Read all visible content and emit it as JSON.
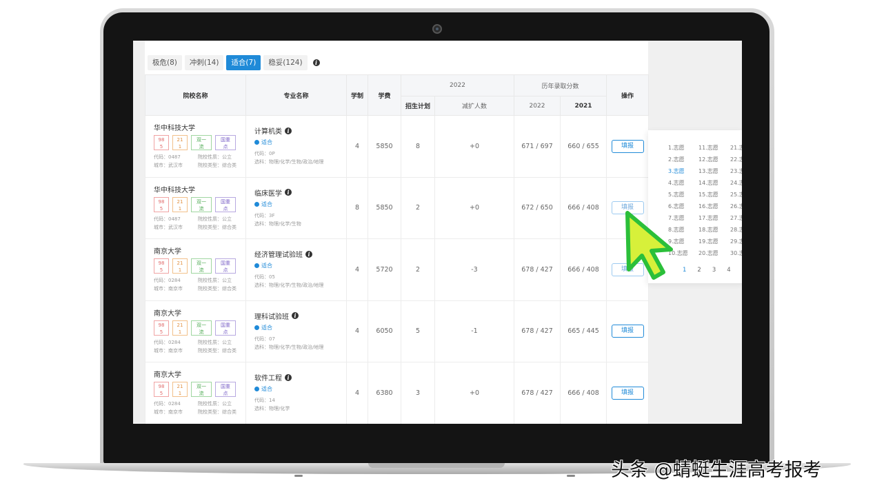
{
  "tabs": [
    {
      "label": "极危(8)"
    },
    {
      "label": "冲刺(14)"
    },
    {
      "label": "适合(7)"
    },
    {
      "label": "稳妥(124)"
    }
  ],
  "table": {
    "headers": {
      "school": "院校名称",
      "major": "专业名称",
      "duration": "学制",
      "tuition": "学费",
      "year_group": "2022",
      "plan": "招生计划",
      "change": "减扩人数",
      "history": "历年录取分数",
      "y2022": "2022",
      "y2021": "2021",
      "action": "操作"
    },
    "rows": [
      {
        "school": "华中科技大学",
        "badges": [
          "98\n5",
          "21\n1",
          "双一\n流",
          "国重\n点"
        ],
        "code": "代码：0487",
        "nature": "院校性质：公立",
        "city": "城市：武汉市",
        "type": "院校类型：综合类",
        "major": "计算机类",
        "fit": "适合",
        "major_code": "代码：0P",
        "subjects": "选科：物理/化学/生物/政治/地理",
        "duration": "4",
        "tuition": "5850",
        "plan": "8",
        "change": "+0",
        "s2022": "671 / 697",
        "s2021": "660 / 655",
        "btn": "填报"
      },
      {
        "school": "华中科技大学",
        "badges": [
          "98\n5",
          "21\n1",
          "双一\n流",
          "国重\n点"
        ],
        "code": "代码：0487",
        "nature": "院校性质：公立",
        "city": "城市：武汉市",
        "type": "院校类型：综合类",
        "major": "临床医学",
        "fit": "适合",
        "major_code": "代码：3F",
        "subjects": "选科：物理/化学/生物",
        "duration": "8",
        "tuition": "5850",
        "plan": "2",
        "change": "+0",
        "s2022": "672 / 650",
        "s2021": "666 / 408",
        "btn": "填报"
      },
      {
        "school": "南京大学",
        "badges": [
          "98\n5",
          "21\n1",
          "双一\n流",
          "国重\n点"
        ],
        "code": "代码：0284",
        "nature": "院校性质：公立",
        "city": "城市：南京市",
        "type": "院校类型：综合类",
        "major": "经济管理试验班",
        "fit": "适合",
        "major_code": "代码：05",
        "subjects": "选科：物理/化学/生物/政治/地理",
        "duration": "4",
        "tuition": "5720",
        "plan": "2",
        "change": "-3",
        "s2022": "678 / 427",
        "s2021": "666 / 408",
        "btn": "填报"
      },
      {
        "school": "南京大学",
        "badges": [
          "98\n5",
          "21\n1",
          "双一\n流",
          "国重\n点"
        ],
        "code": "代码：0284",
        "nature": "院校性质：公立",
        "city": "城市：南京市",
        "type": "院校类型：综合类",
        "major": "理科试验班",
        "fit": "适合",
        "major_code": "代码：07",
        "subjects": "选科：物理/化学/生物/政治/地理",
        "duration": "4",
        "tuition": "6050",
        "plan": "5",
        "change": "-1",
        "s2022": "678 / 427",
        "s2021": "665 / 445",
        "btn": "填报"
      },
      {
        "school": "南京大学",
        "badges": [
          "98\n5",
          "21\n1",
          "双一\n流",
          "国重\n点"
        ],
        "code": "代码：0284",
        "nature": "院校性质：公立",
        "city": "城市：南京市",
        "type": "院校类型：综合类",
        "major": "软件工程",
        "fit": "适合",
        "major_code": "代码：14",
        "subjects": "选科：物理/化学",
        "duration": "4",
        "tuition": "6380",
        "plan": "3",
        "change": "+0",
        "s2022": "678 / 427",
        "s2021": "666 / 408",
        "btn": "填报"
      }
    ]
  },
  "volunteers": {
    "col1": [
      "1.志愿",
      "2.志愿",
      "3.志愿",
      "4.志愿",
      "5.志愿",
      "6.志愿",
      "7.志愿",
      "8.志愿",
      "9.志愿",
      "10.志愿"
    ],
    "col2": [
      "11.志愿",
      "12.志愿",
      "13.志愿",
      "14.志愿",
      "15.志愿",
      "16.志愿",
      "17.志愿",
      "18.志愿",
      "19.志愿",
      "20.志愿"
    ],
    "col3": [
      "21.志",
      "22.志",
      "23.志",
      "24.志",
      "25.志",
      "26.志",
      "27.志",
      "28.志",
      "29.志",
      "30.志"
    ],
    "selected": "3.志愿",
    "pages": [
      "1",
      "2",
      "3",
      "4"
    ]
  },
  "watermark": "头条 @蜻蜓生涯高考报考",
  "colors": {
    "accent": "#1f8ad8",
    "positive": "#3fb94a",
    "negative": "#e05050",
    "cursor": "#d7f03a"
  }
}
